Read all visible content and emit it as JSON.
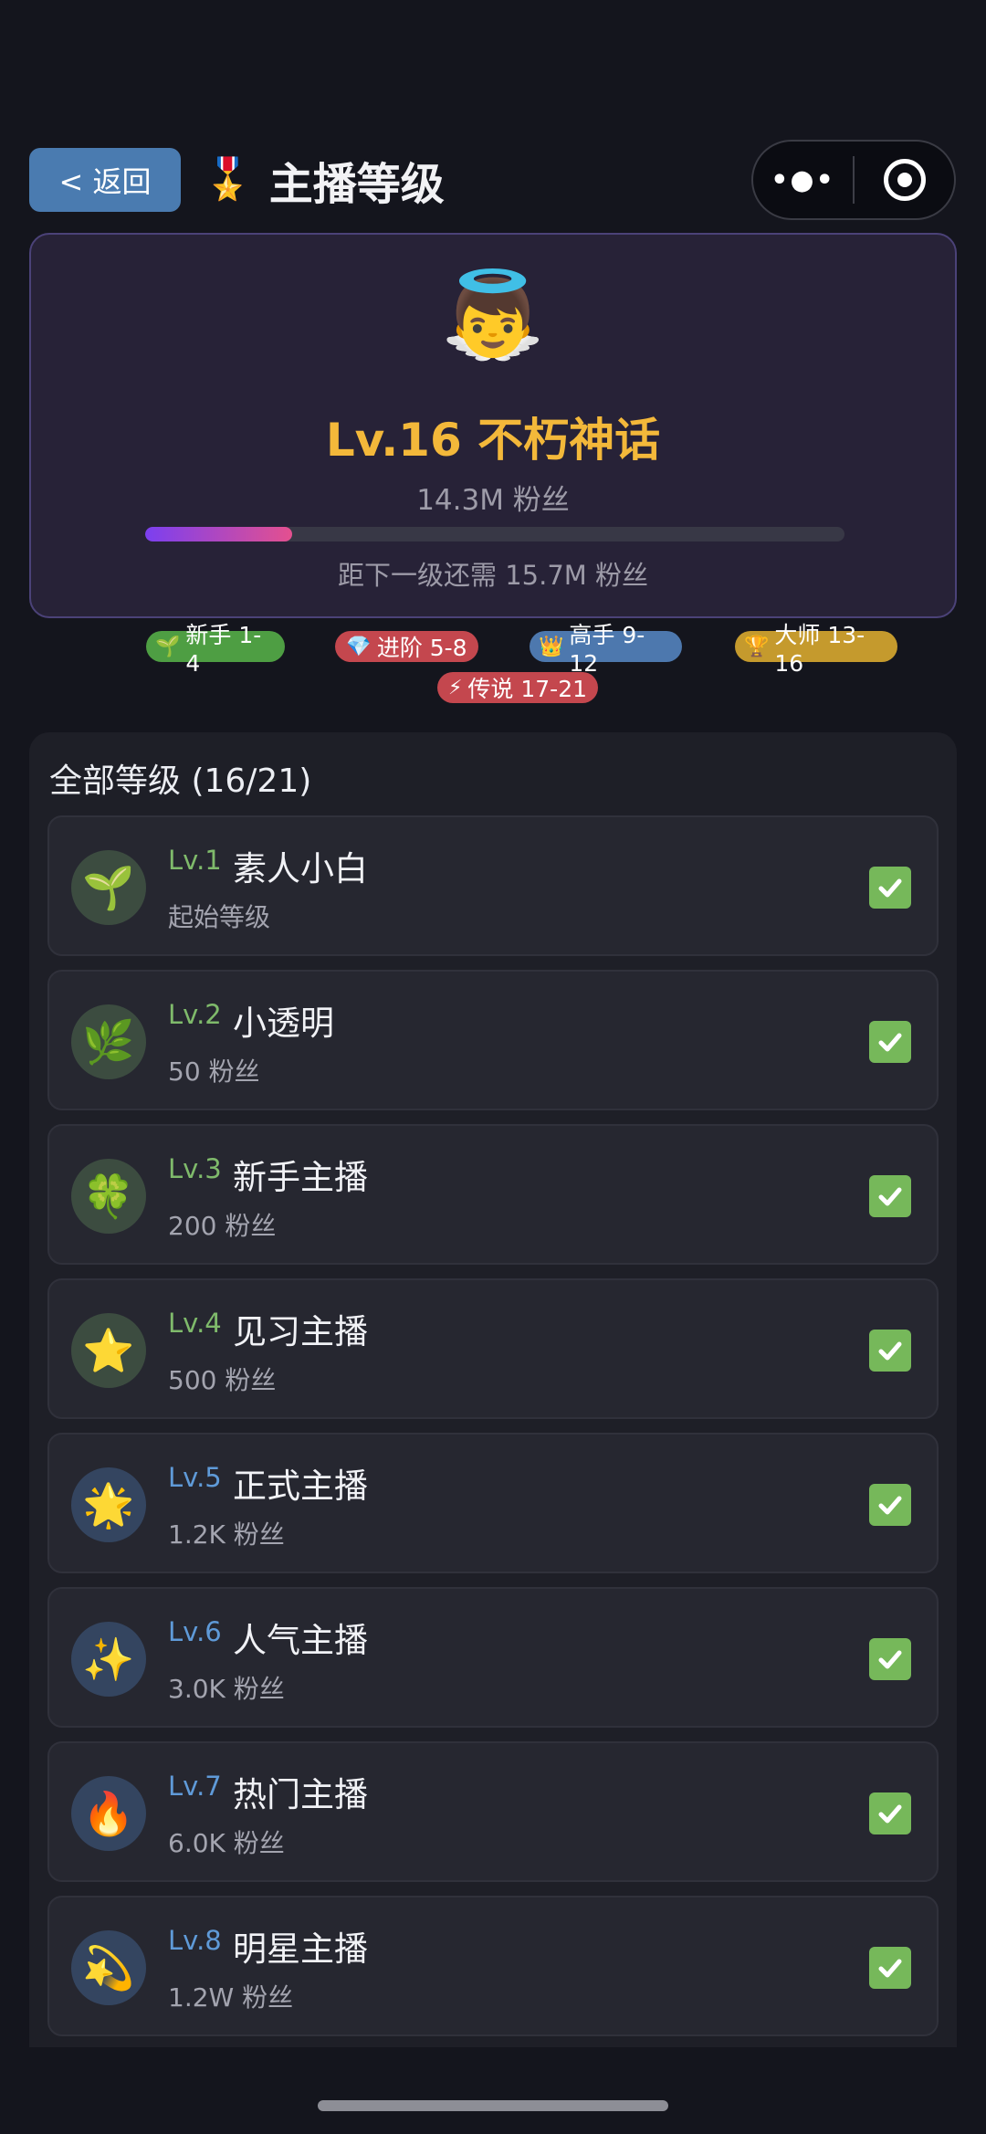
{
  "header": {
    "back_label": "< 返回",
    "medal_icon": "🎖️",
    "title": "主播等级",
    "capsule_more": "•●•"
  },
  "hero": {
    "emoji": "👼",
    "level_title": "Lv.16 不朽神话",
    "fans": "14.3M 粉丝",
    "progress_fraction": 0.21,
    "next_text": "距下一级还需 15.7M 粉丝"
  },
  "tiers": [
    {
      "icon": "🌱",
      "label": "新手 1-4",
      "color": "#4e9e43"
    },
    {
      "icon": "💎",
      "label": "进阶 5-8",
      "color": "#c4474e"
    },
    {
      "icon": "👑",
      "label": "高手 9-12",
      "color": "#4d78ae"
    },
    {
      "icon": "🏆",
      "label": "大师 13-16",
      "color": "#c59a2d"
    },
    {
      "icon": "⚡",
      "label": "传说 17-21",
      "color": "#c4474e"
    }
  ],
  "list": {
    "title": "全部等级 (16/21)",
    "items": [
      {
        "lv": "Lv.1",
        "name": "素人小白",
        "sub": "起始等级",
        "icon": "🌱",
        "icon_bg": "#3c4c40",
        "lv_color": "#7fba6b"
      },
      {
        "lv": "Lv.2",
        "name": "小透明",
        "sub": "50 粉丝",
        "icon": "🌿",
        "icon_bg": "#3c4c40",
        "lv_color": "#7fba6b"
      },
      {
        "lv": "Lv.3",
        "name": "新手主播",
        "sub": "200 粉丝",
        "icon": "🍀",
        "icon_bg": "#3c4c40",
        "lv_color": "#7fba6b"
      },
      {
        "lv": "Lv.4",
        "name": "见习主播",
        "sub": "500 粉丝",
        "icon": "⭐",
        "icon_bg": "#3c4c40",
        "lv_color": "#7fba6b"
      },
      {
        "lv": "Lv.5",
        "name": "正式主播",
        "sub": "1.2K 粉丝",
        "icon": "🌟",
        "icon_bg": "#344560",
        "lv_color": "#5f9ad8"
      },
      {
        "lv": "Lv.6",
        "name": "人气主播",
        "sub": "3.0K 粉丝",
        "icon": "✨",
        "icon_bg": "#344560",
        "lv_color": "#5f9ad8"
      },
      {
        "lv": "Lv.7",
        "name": "热门主播",
        "sub": "6.0K 粉丝",
        "icon": "🔥",
        "icon_bg": "#344560",
        "lv_color": "#5f9ad8"
      },
      {
        "lv": "Lv.8",
        "name": "明星主播",
        "sub": "1.2W 粉丝",
        "icon": "💫",
        "icon_bg": "#344560",
        "lv_color": "#5f9ad8"
      }
    ]
  }
}
